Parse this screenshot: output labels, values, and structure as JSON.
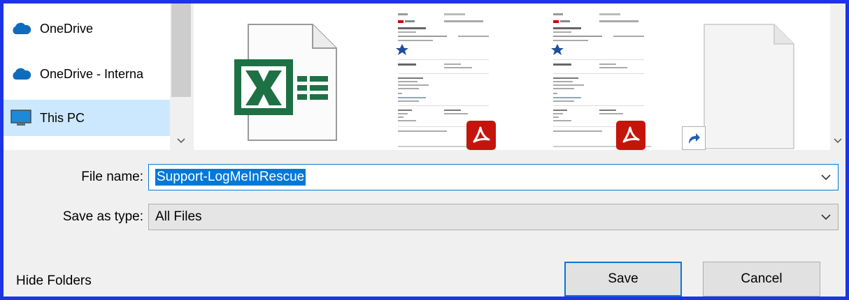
{
  "nav": {
    "items": [
      {
        "label": "OneDrive",
        "icon": "onedrive-cloud-icon"
      },
      {
        "label": "OneDrive - Interna",
        "icon": "onedrive-cloud-icon"
      },
      {
        "label": "This PC",
        "icon": "computer-icon",
        "selected": true
      }
    ]
  },
  "files": {
    "thumbnails": [
      {
        "type": "excel-file",
        "icon": "excel-icon"
      },
      {
        "type": "pdf-file",
        "icon": "pdf-icon"
      },
      {
        "type": "pdf-file",
        "icon": "pdf-icon"
      },
      {
        "type": "shortcut-file",
        "icon": "shortcut-icon"
      }
    ]
  },
  "form": {
    "file_name_label": "File name:",
    "file_name_value": "Support-LogMeInRescue",
    "save_type_label": "Save as type:",
    "save_type_value": "All Files"
  },
  "footer": {
    "hide_folders_label": "Hide Folders",
    "save_label": "Save",
    "cancel_label": "Cancel"
  },
  "colors": {
    "frame_border": "#1c33e6",
    "selection": "#0078d7",
    "nav_selected": "#cce8ff",
    "excel_green": "#1e7145",
    "pdf_red": "#c4150d"
  }
}
